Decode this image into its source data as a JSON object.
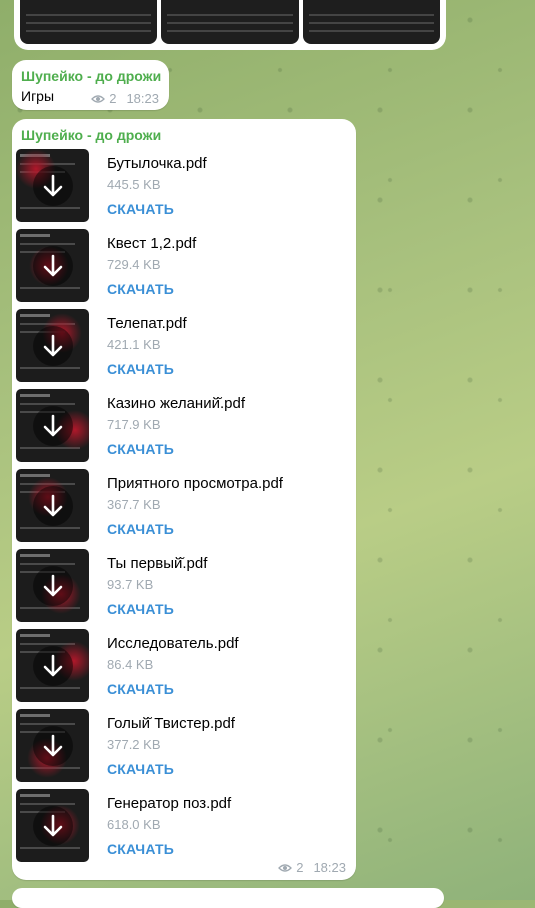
{
  "colors": {
    "sender": "#4fae4e",
    "link": "#3a8fd6",
    "meta": "#a0a9b1",
    "bubble": "#ffffff"
  },
  "message_1": {
    "sender": "Шупейко - до дрожи",
    "text": "Игры",
    "views": "2",
    "time": "18:23"
  },
  "message_2": {
    "sender": "Шупейко - до дрожи",
    "views": "2",
    "time": "18:23",
    "download_label": "СКАЧАТЬ",
    "files": [
      {
        "name": "Бутылочка.pdf",
        "size": "445.5 KB"
      },
      {
        "name": "Квест 1,2.pdf",
        "size": "729.4 KB"
      },
      {
        "name": "Телепат.pdf",
        "size": "421.1 KB"
      },
      {
        "name": "Казино желаний̆.pdf",
        "size": "717.9 KB"
      },
      {
        "name": "Приятного просмотра.pdf",
        "size": "367.7 KB"
      },
      {
        "name": "Ты первый̆.pdf",
        "size": "93.7 KB"
      },
      {
        "name": "Исследователь.pdf",
        "size": "86.4 KB"
      },
      {
        "name": "Голый̆ Твистер.pdf",
        "size": "377.2 KB"
      },
      {
        "name": "Генератор поз.pdf",
        "size": "618.0 KB"
      }
    ]
  },
  "icons": {
    "views": "eye-icon",
    "download": "download-arrow-icon"
  }
}
